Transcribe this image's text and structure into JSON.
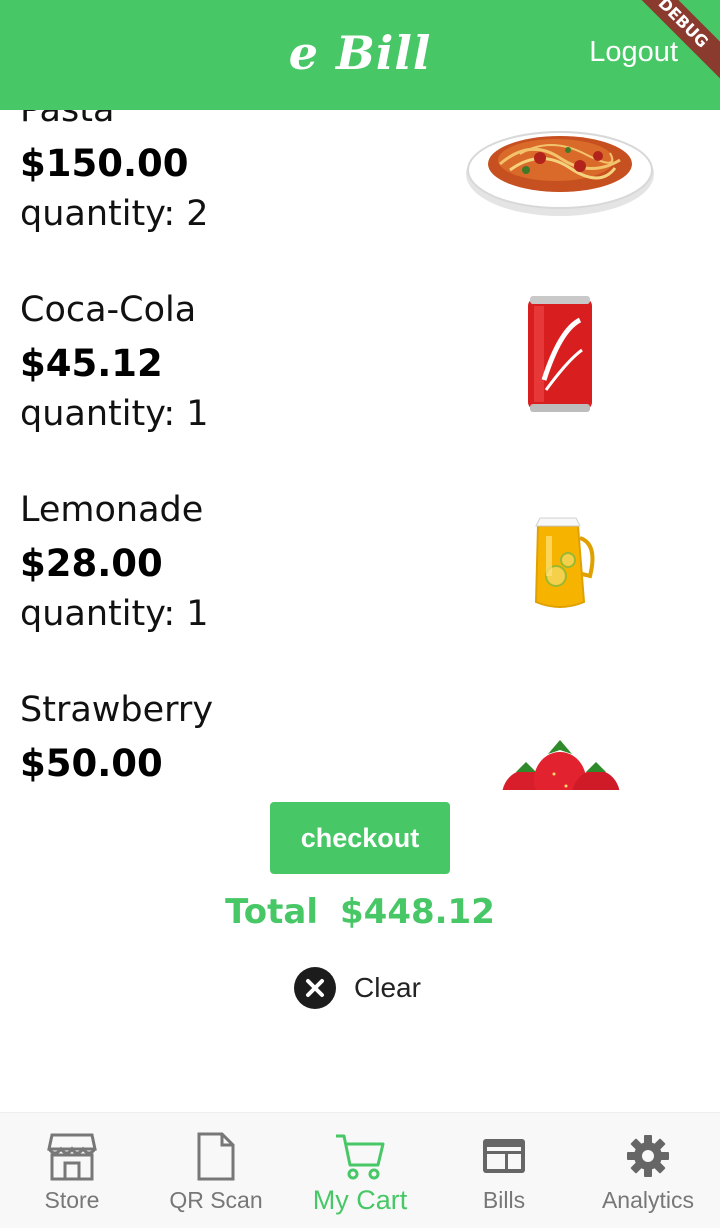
{
  "header": {
    "title": "e Bill",
    "logout_label": "Logout",
    "debug_banner": "DEBUG",
    "background_color": "#47c766"
  },
  "cart": {
    "items": [
      {
        "name": "Pasta",
        "price": "$150.00",
        "quantity": "quantity: 2",
        "image_icon": "pasta-plate-icon"
      },
      {
        "name": "Coca-Cola",
        "price": "$45.12",
        "quantity": "quantity: 1",
        "image_icon": "cola-can-icon"
      },
      {
        "name": "Lemonade",
        "price": "$28.00",
        "quantity": "quantity: 1",
        "image_icon": "lemonade-jug-icon"
      },
      {
        "name": "Strawberry",
        "price": "$50.00",
        "quantity": "",
        "image_icon": "strawberries-icon"
      }
    ]
  },
  "checkout": {
    "button_label": "checkout",
    "total_label": "Total",
    "total_value": "$448.12",
    "clear_label": "Clear",
    "accent_color": "#47c766"
  },
  "bottom_nav": {
    "items": [
      {
        "label": "Store",
        "icon": "store-icon",
        "active": false
      },
      {
        "label": "QR Scan",
        "icon": "document-icon",
        "active": false
      },
      {
        "label": "My Cart",
        "icon": "cart-icon",
        "active": true
      },
      {
        "label": "Bills",
        "icon": "bills-icon",
        "active": false
      },
      {
        "label": "Analytics",
        "icon": "gear-icon",
        "active": false
      }
    ]
  }
}
